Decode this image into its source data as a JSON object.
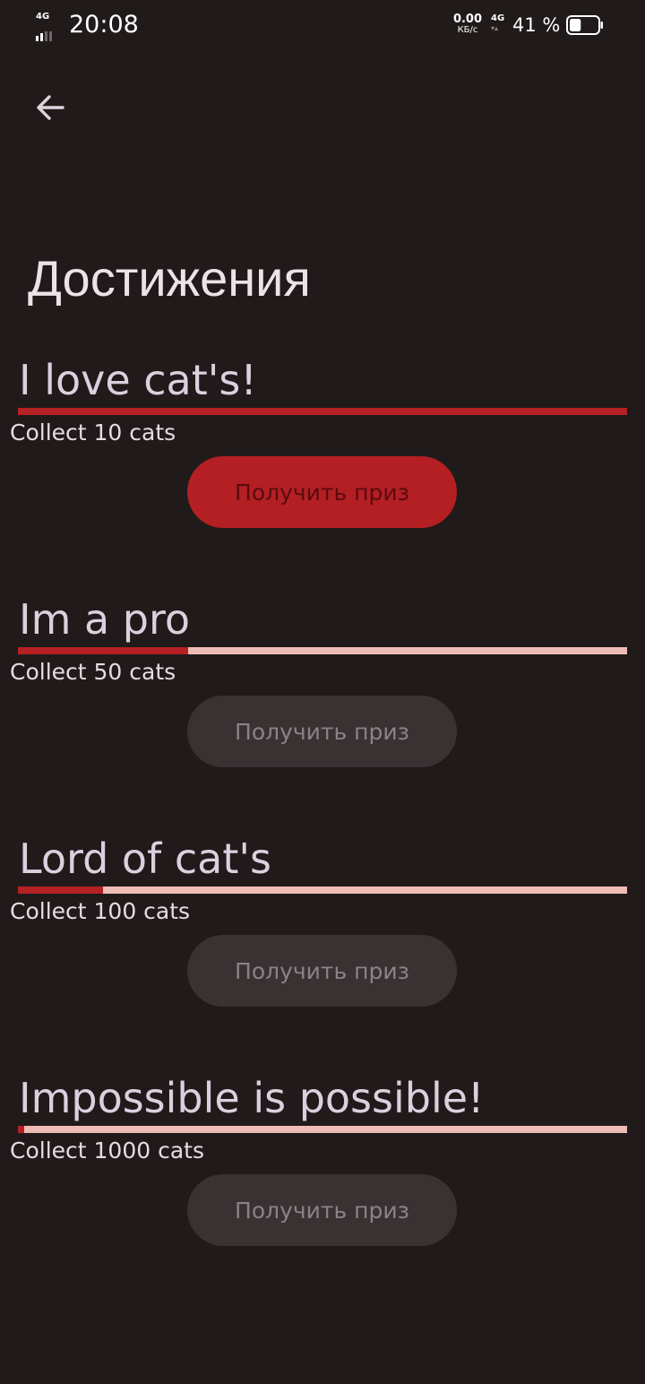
{
  "status_bar": {
    "network_left": "4G",
    "time": "20:08",
    "speed_value": "0.00",
    "speed_unit": "КБ/с",
    "network_right": "4G",
    "battery_text": "41 %",
    "battery_level": 0.41
  },
  "app_bar": {
    "back_icon": "arrow-back-icon"
  },
  "page": {
    "title": "Достижения"
  },
  "colors": {
    "background": "#201b1a",
    "progress_fill": "#b52023",
    "progress_track": "#efbcb5",
    "button_enabled": "#b31f23",
    "button_disabled": "#383233"
  },
  "achievements": [
    {
      "title": "I love cat's!",
      "description": "Collect 10 cats",
      "progress": 1.0,
      "button_label": "Получить приз",
      "button_enabled": true
    },
    {
      "title": "Im a pro",
      "description": "Collect 50 cats",
      "progress": 0.28,
      "button_label": "Получить приз",
      "button_enabled": false
    },
    {
      "title": "Lord of cat's",
      "description": "Collect 100 cats",
      "progress": 0.14,
      "button_label": "Получить приз",
      "button_enabled": false
    },
    {
      "title": "Impossible is possible!",
      "description": "Collect 1000 cats",
      "progress": 0.01,
      "button_label": "Получить приз",
      "button_enabled": false
    }
  ]
}
